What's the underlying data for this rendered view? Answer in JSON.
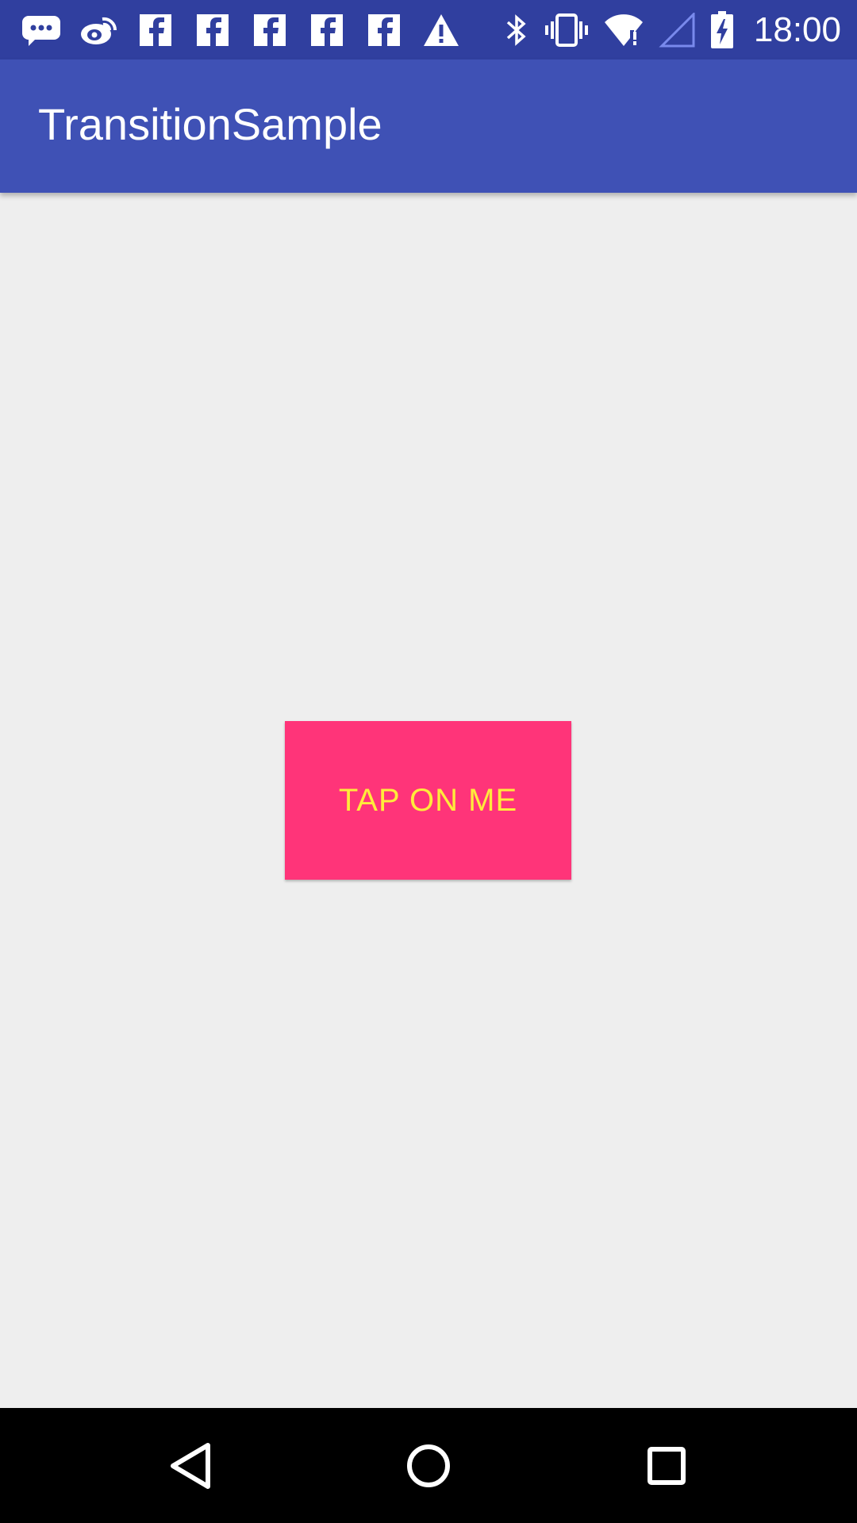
{
  "status_bar": {
    "time": "18:00",
    "background_color": "#303f9f",
    "left_icons": [
      "chat-bubble-icon",
      "weibo-icon",
      "facebook-icon",
      "facebook-icon",
      "facebook-icon",
      "facebook-icon",
      "facebook-icon",
      "warning-icon"
    ],
    "right_icons": [
      "bluetooth-icon",
      "vibrate-icon",
      "wifi-icon",
      "signal-icon",
      "battery-charging-icon"
    ]
  },
  "app_bar": {
    "title": "TransitionSample",
    "background_color": "#3f51b5"
  },
  "main": {
    "button_label": "TAP ON ME",
    "button_color": "#ff3479",
    "button_text_color": "#ffeb3b",
    "background_color": "#eeeeee"
  },
  "nav_bar": {
    "buttons": [
      "back-icon",
      "home-icon",
      "recents-icon"
    ]
  }
}
